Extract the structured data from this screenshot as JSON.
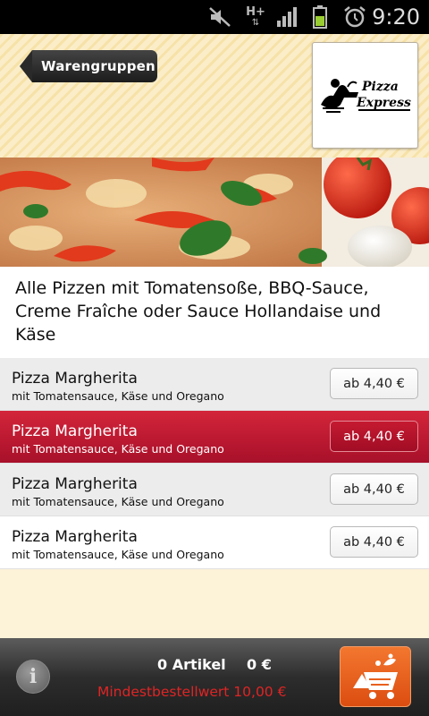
{
  "status_bar": {
    "network": "H+",
    "time": "9:20",
    "icons": [
      "mute-icon",
      "network-h-plus-icon",
      "signal-icon",
      "battery-icon",
      "alarm-icon"
    ]
  },
  "header": {
    "back_label": "Warengruppen",
    "logo_text_line1": "Pizza",
    "logo_text_line2": "Express"
  },
  "category": {
    "description": "Alle Pizzen mit Tomatensoße, BBQ-Sauce, Creme Fraîche oder Sauce Hollandaise und Käse"
  },
  "products": [
    {
      "name": "Pizza Margherita",
      "subtitle": "mit Tomatensauce, Käse und Oregano",
      "price": "ab 4,40 €",
      "selected": false
    },
    {
      "name": "Pizza Margherita",
      "subtitle": "mit Tomatensauce, Käse und Oregano",
      "price": "ab 4,40 €",
      "selected": true
    },
    {
      "name": "Pizza Margherita",
      "subtitle": "mit Tomatensauce, Käse und Oregano",
      "price": "ab 4,40 €",
      "selected": false
    },
    {
      "name": "Pizza Margherita",
      "subtitle": "mit Tomatensauce, Käse und Oregano",
      "price": "ab 4,40 €",
      "selected": false
    }
  ],
  "footer": {
    "info_label": "i",
    "article_count": "0 Artikel",
    "total": "0 €",
    "min_order": "Mindestbestellwert 10,00 €"
  },
  "colors": {
    "accent_red": "#b8152d",
    "cart_orange": "#e8601d",
    "min_order_red": "#e02424"
  }
}
